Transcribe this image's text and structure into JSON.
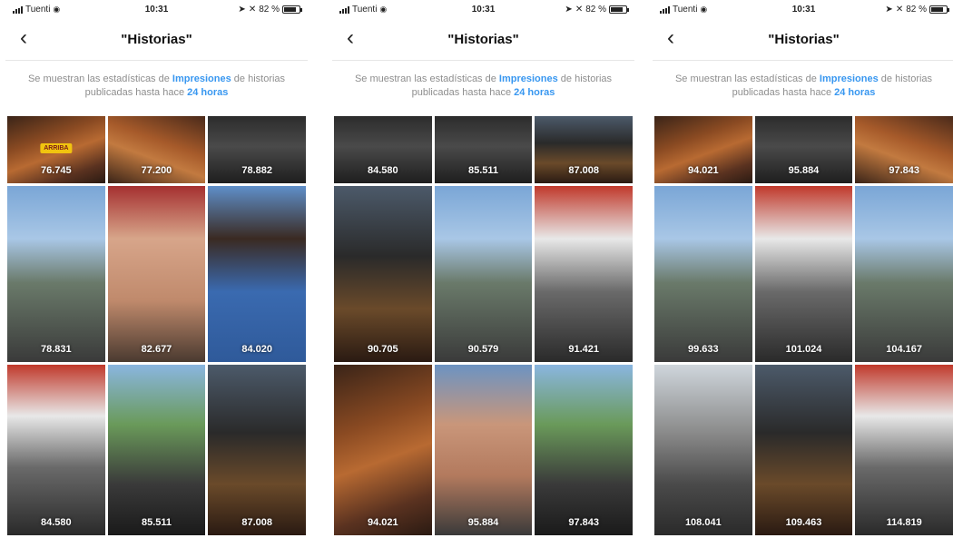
{
  "screens": [
    {
      "status": {
        "carrier": "Tuenti",
        "time": "10:31",
        "battery": "82 %"
      },
      "header": {
        "back_icon": "chevron-left-icon",
        "title": "\"Historias\""
      },
      "info": {
        "prefix": "Se muestran las estadísticas de",
        "metric": "Impresiones",
        "middle": "de historias publicadas hasta hace",
        "window": "24 horas"
      },
      "tiles": [
        {
          "impressions": "76.745",
          "style": "bg-meat",
          "sticker": "ARRIBA",
          "sticker_style": "yellow"
        },
        {
          "impressions": "77.200",
          "style": "bg-meat2"
        },
        {
          "impressions": "78.882",
          "style": "bg-dark"
        },
        {
          "impressions": "78.831",
          "style": "bg-sky-crowd"
        },
        {
          "impressions": "82.677",
          "style": "bg-face2"
        },
        {
          "impressions": "84.020",
          "style": "bg-blue-shirt"
        },
        {
          "impressions": "84.580",
          "style": "bg-red"
        },
        {
          "impressions": "85.511",
          "style": "bg-green"
        },
        {
          "impressions": "87.008",
          "style": "bg-grill"
        }
      ]
    },
    {
      "status": {
        "carrier": "Tuenti",
        "time": "10:31",
        "battery": "82 %"
      },
      "header": {
        "back_icon": "chevron-left-icon",
        "title": "\"Historias\""
      },
      "info": {
        "prefix": "Se muestran las estadísticas de",
        "metric": "Impresiones",
        "middle": "de historias publicadas hasta hace",
        "window": "24 horas"
      },
      "tiles": [
        {
          "impressions": "84.580",
          "style": "bg-dark"
        },
        {
          "impressions": "85.511",
          "style": "bg-dark"
        },
        {
          "impressions": "87.008",
          "style": "bg-grill"
        },
        {
          "impressions": "90.705",
          "style": "bg-grill"
        },
        {
          "impressions": "90.579",
          "style": "bg-sky-crowd"
        },
        {
          "impressions": "91.421",
          "style": "bg-red"
        },
        {
          "impressions": "94.021",
          "style": "bg-meat"
        },
        {
          "impressions": "95.884",
          "style": "bg-face"
        },
        {
          "impressions": "97.843",
          "style": "bg-green"
        }
      ]
    },
    {
      "status": {
        "carrier": "Tuenti",
        "time": "10:31",
        "battery": "82 %"
      },
      "header": {
        "back_icon": "chevron-left-icon",
        "title": "\"Historias\""
      },
      "info": {
        "prefix": "Se muestran las estadísticas de",
        "metric": "Impresiones",
        "middle": "de historias publicadas hasta hace",
        "window": "24 horas"
      },
      "tiles": [
        {
          "impressions": "94.021",
          "style": "bg-meat"
        },
        {
          "impressions": "95.884",
          "style": "bg-dark"
        },
        {
          "impressions": "97.843",
          "style": "bg-meat2"
        },
        {
          "impressions": "99.633",
          "style": "bg-sky-crowd"
        },
        {
          "impressions": "101.024",
          "style": "bg-red"
        },
        {
          "impressions": "104.167",
          "style": "bg-sky-crowd"
        },
        {
          "impressions": "108.041",
          "style": "bg-steam"
        },
        {
          "impressions": "109.463",
          "style": "bg-grill"
        },
        {
          "impressions": "114.819",
          "style": "bg-red"
        }
      ]
    }
  ],
  "colors": {
    "link": "#3897f0",
    "info_text": "#8e8e8e",
    "title": "#111111"
  }
}
